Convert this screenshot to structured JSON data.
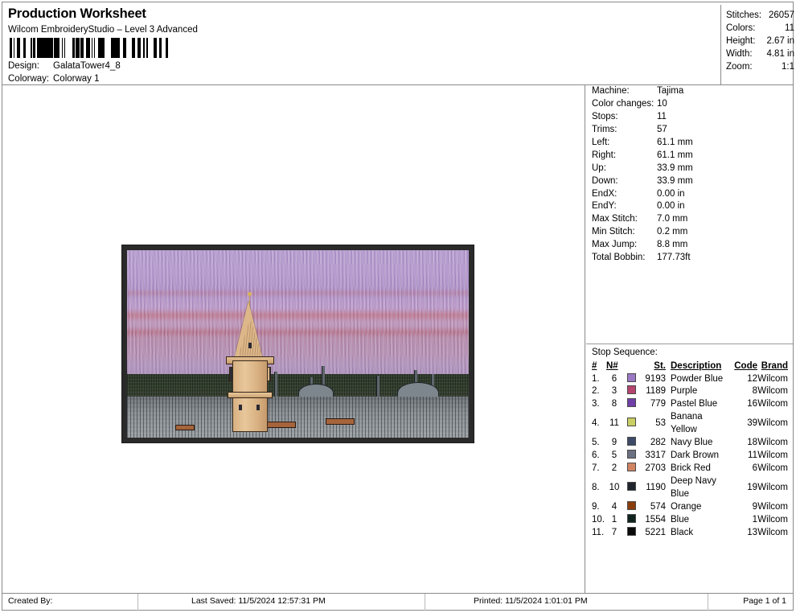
{
  "header": {
    "title": "Production Worksheet",
    "subtitle": "Wilcom EmbroideryStudio – Level 3 Advanced",
    "design_label": "Design:",
    "design_value": "GalataTower4_8",
    "colorway_label": "Colorway:",
    "colorway_value": "Colorway 1",
    "barcode_name": "design-barcode"
  },
  "summary": [
    {
      "label": "Stitches:",
      "value": "26057"
    },
    {
      "label": "Colors:",
      "value": "11"
    },
    {
      "label": "Height:",
      "value": "2.67 in"
    },
    {
      "label": "Width:",
      "value": "4.81 in"
    },
    {
      "label": "Zoom:",
      "value": "1:1"
    }
  ],
  "specs": [
    {
      "label": "Machine:",
      "value": "Tajima"
    },
    {
      "label": "Color changes:",
      "value": "10"
    },
    {
      "label": "Stops:",
      "value": "11"
    },
    {
      "label": "Trims:",
      "value": "57"
    },
    {
      "label": "Left:",
      "value": "61.1 mm"
    },
    {
      "label": "Right:",
      "value": "61.1 mm"
    },
    {
      "label": "Up:",
      "value": "33.9 mm"
    },
    {
      "label": "Down:",
      "value": "33.9 mm"
    },
    {
      "label": "EndX:",
      "value": "0.00 in"
    },
    {
      "label": "EndY:",
      "value": "0.00 in"
    },
    {
      "label": "Max Stitch:",
      "value": "7.0 mm"
    },
    {
      "label": "Min Stitch:",
      "value": "0.2 mm"
    },
    {
      "label": "Max Jump:",
      "value": "8.8 mm"
    },
    {
      "label": "Total Bobbin:",
      "value": "177.73ft"
    }
  ],
  "stop_sequence": {
    "label": "Stop Sequence:",
    "columns": [
      "#",
      "N#",
      "St.",
      "Description",
      "Code",
      "Brand"
    ],
    "rows": [
      {
        "num": "1.",
        "nnum": "6",
        "color": "#9b79c4",
        "stitches": "9193",
        "description": "Powder Blue",
        "code": "12",
        "brand": "Wilcom"
      },
      {
        "num": "2.",
        "nnum": "3",
        "color": "#b5446e",
        "stitches": "1189",
        "description": "Purple",
        "code": "8",
        "brand": "Wilcom"
      },
      {
        "num": "3.",
        "nnum": "8",
        "color": "#6f3fa8",
        "stitches": "779",
        "description": "Pastel Blue",
        "code": "16",
        "brand": "Wilcom"
      },
      {
        "num": "4.",
        "nnum": "11",
        "color": "#c3c martes",
        "stitches": "53",
        "description": "Banana Yellow",
        "code": "39",
        "brand": "Wilcom"
      },
      {
        "num": "5.",
        "nnum": "9",
        "color": "#3d4a68",
        "stitches": "282",
        "description": "Navy Blue",
        "code": "18",
        "brand": "Wilcom"
      },
      {
        "num": "6.",
        "nnum": "5",
        "color": "#6b7180",
        "stitches": "3317",
        "description": "Dark Brown",
        "code": "11",
        "brand": "Wilcom"
      },
      {
        "num": "7.",
        "nnum": "2",
        "color": "#d08462",
        "stitches": "2703",
        "description": "Brick Red",
        "code": "6",
        "brand": "Wilcom"
      },
      {
        "num": "8.",
        "nnum": "10",
        "color": "#20242c",
        "stitches": "1190",
        "description": "Deep Navy Blue",
        "code": "19",
        "brand": "Wilcom"
      },
      {
        "num": "9.",
        "nnum": "4",
        "color": "#8a3c0c",
        "stitches": "574",
        "description": "Orange",
        "code": "9",
        "brand": "Wilcom"
      },
      {
        "num": "10.",
        "nnum": "1",
        "color": "#10241f",
        "stitches": "1554",
        "description": "Blue",
        "code": "1",
        "brand": "Wilcom"
      },
      {
        "num": "11.",
        "nnum": "7",
        "color": "#0a0a0a",
        "stitches": "5221",
        "description": "Black",
        "code": "13",
        "brand": "Wilcom"
      }
    ]
  },
  "footer": {
    "created_by": "Created By:",
    "last_saved": "Last Saved: 11/5/2024 12:57:31 PM",
    "printed": "Printed: 11/5/2024 1:01:01 PM",
    "page": "Page 1 of 1"
  },
  "design_preview": {
    "name": "galata-tower-embroidery-preview",
    "alt": "Galata Tower Istanbul skyline embroidery stitch preview"
  }
}
